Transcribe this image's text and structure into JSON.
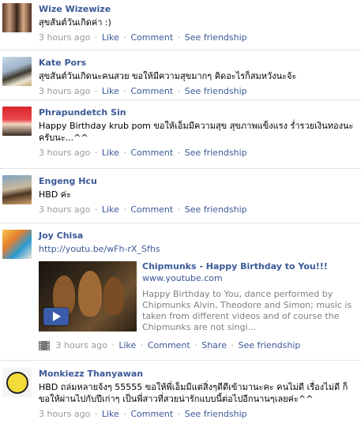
{
  "meta_labels": {
    "like": "Like",
    "comment": "Comment",
    "share": "Share",
    "see_friendship": "See friendship",
    "separator": "·"
  },
  "posts": [
    {
      "name": "Wize Wizewize",
      "message": "สุขสันต์วันเกิดค่า :)",
      "time": "3 hours ago"
    },
    {
      "name": "Kate Pors",
      "message": "สุขสันต์วันเกิดนะคนสวย ขอให้มีความสุขมากๆ คิดอะไรก็สมหวังนะจ้ะ",
      "time": "3 hours ago"
    },
    {
      "name": "Phrapundetch Sin",
      "message": "Happy Birthday krub pom ขอให้เอ็มมีความสุข สุขภาพแข็งแรง ร่ำรวยเงินทองนะครับนะ...^^",
      "time": "3 hours ago"
    },
    {
      "name": "Engeng Hcu",
      "message": "HBD ค่ะ",
      "time": "3 hours ago"
    },
    {
      "name": "Joy Chisa",
      "message": "http://youtu.be/wFh-rX_Sfhs",
      "time": "3 hours ago",
      "share": {
        "title": "Chipmunks - Happy Birthday to You!!!",
        "domain": "www.youtube.com",
        "description": "Happy Birthday to You, dance performed by Chipmunks Alvin, Theodore and Simon; music is taken from different videos and of course the Chipmunks are not singi..."
      }
    },
    {
      "name": "Monkiezz Thanyawan",
      "message": "HBD ถล่มหลายจ้งๆ 55555 ขอให้พี่เอ็มมีแต่สิ่งๆดีดีเข้ามานะคะ คนไม่ดี เรื่องไม่ดี ก็ขอให้ผ่านไปกับปีเก่าๆ เป็นพี่สาวที่สวยน่ารักแบบนี้ต่อไปอีกนานๆเลยค่ะ^^",
      "time": "3 hours ago"
    }
  ]
}
